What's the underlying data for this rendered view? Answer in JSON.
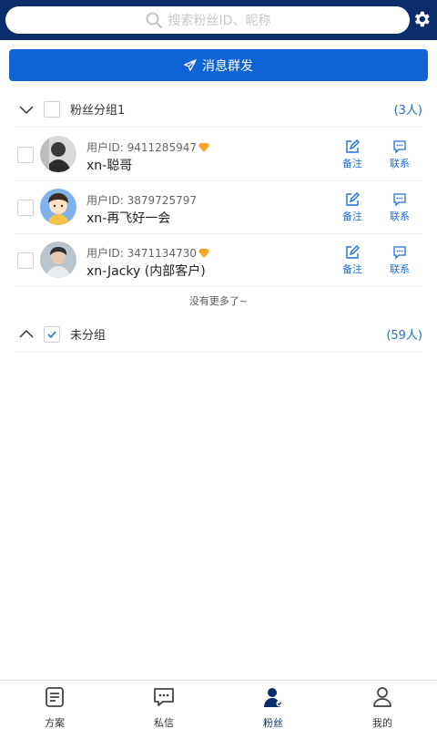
{
  "search": {
    "placeholder": "搜索粉丝ID、昵称"
  },
  "broadcast": {
    "label": "消息群发"
  },
  "groups": [
    {
      "title": "粉丝分组1",
      "count": "(3人)",
      "expanded": true,
      "checked": false,
      "members": [
        {
          "uid": "用户ID: 9411285947",
          "name": "xn-聪哥",
          "vip": true
        },
        {
          "uid": "用户ID: 3879725797",
          "name": "xn-再飞好一会",
          "vip": false
        },
        {
          "uid": "用户ID: 3471134730",
          "name": "xn-Jacky (内部客户)",
          "vip": true
        }
      ]
    },
    {
      "title": "未分组",
      "count": "(59人)",
      "expanded": false,
      "checked": true
    }
  ],
  "actions": {
    "note": "备注",
    "contact": "联系"
  },
  "no_more": "没有更多了~",
  "nav": [
    {
      "label": "方案",
      "icon": "document-icon"
    },
    {
      "label": "私信",
      "icon": "message-icon"
    },
    {
      "label": "粉丝",
      "icon": "fans-icon",
      "active": true
    },
    {
      "label": "我的",
      "icon": "user-icon"
    }
  ],
  "colors": {
    "header": "#0b2d6b",
    "primary": "#0e64d4",
    "link": "#1e6fd6",
    "vip": "#f5a623"
  }
}
